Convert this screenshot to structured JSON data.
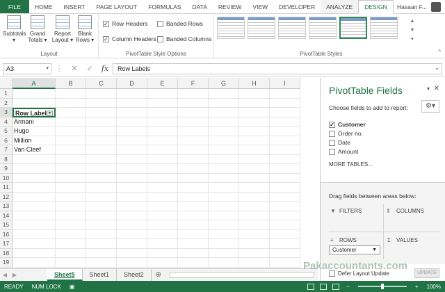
{
  "tabs": {
    "file": "FILE",
    "home": "HOME",
    "insert": "INSERT",
    "page_layout": "PAGE LAYOUT",
    "formulas": "FORMULAS",
    "data": "DATA",
    "review": "REVIEW",
    "view": "VIEW",
    "developer": "DEVELOPER",
    "analyze": "ANALYZE",
    "design": "DESIGN",
    "user": "Hasaan F..."
  },
  "ribbon": {
    "layout": {
      "subtotals": "Subtotals",
      "grand_totals": "Grand Totals",
      "report_layout": "Report Layout",
      "blank_rows": "Blank Rows",
      "label": "Layout"
    },
    "style_options": {
      "row_headers": "Row Headers",
      "column_headers": "Column Headers",
      "banded_rows": "Banded Rows",
      "banded_columns": "Banded Columns",
      "label": "PivotTable Style Options"
    },
    "styles": {
      "label": "PivotTable Styles"
    }
  },
  "formula_bar": {
    "name_box": "A3",
    "fx": "fx",
    "content": "Row Labels"
  },
  "grid": {
    "columns": [
      "A",
      "B",
      "C",
      "D",
      "E",
      "F",
      "G",
      "H",
      "I"
    ],
    "rows": [
      "1",
      "2",
      "3",
      "4",
      "5",
      "6",
      "7",
      "8",
      "9",
      "10",
      "11",
      "12",
      "13",
      "14",
      "15",
      "16",
      "17",
      "18",
      "19"
    ],
    "cells": {
      "a3": "Row Labels",
      "a4": "Armani",
      "a5": "Hugo",
      "a6": "Million",
      "a7": "Van Cleef"
    }
  },
  "sheets": {
    "s1": "Sheet5",
    "s2": "Sheet1",
    "s3": "Sheet2"
  },
  "pane": {
    "title": "PivotTable Fields",
    "subtitle": "Choose fields to add to report:",
    "fields": [
      "Customer",
      "Order no.",
      "Date",
      "Amount"
    ],
    "more_tables": "MORE TABLES...",
    "drag_text": "Drag fields between areas below:",
    "filters": "FILTERS",
    "columns": "COLUMNS",
    "rows": "ROWS",
    "values": "VALUES",
    "row_chip": "Customer",
    "defer": "Defer Layout Update",
    "update": "UPDATE"
  },
  "status": {
    "ready": "READY",
    "num_lock": "NUM LOCK",
    "zoom": "100%"
  },
  "watermark": "Pakaccountants.com"
}
